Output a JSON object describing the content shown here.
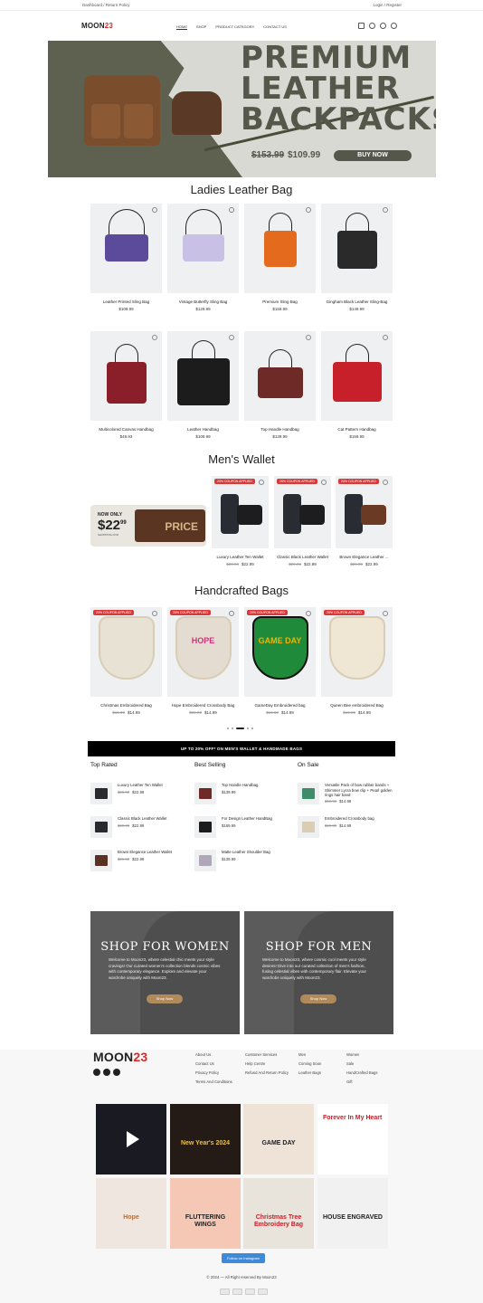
{
  "topbar": {
    "left": "Dashboard / Return Policy",
    "right": "Login / Register"
  },
  "header": {
    "logo": {
      "main": "MOON",
      "accent": "23"
    },
    "nav": [
      "HOME",
      "SHOP",
      "PRODUCT CATEGORY",
      "CONTACT US"
    ]
  },
  "hero": {
    "line1": "PREMIUM",
    "line2": "LEATHER",
    "line3": "BACKPACKS",
    "old_price": "$153.99",
    "new_price": "$109.99",
    "button": "BUY NOW"
  },
  "ladies": {
    "title": "Ladies Leather Bag",
    "items": [
      {
        "name": "Leather Printed Sling Bag",
        "price": "$109.99"
      },
      {
        "name": "Vintage Butterfly Sling Bag",
        "price": "$129.99"
      },
      {
        "name": "Premium Sling Bag",
        "price": "$159.99"
      },
      {
        "name": "Gingham Black Leather Sling-Bag",
        "price": "$149.99"
      },
      {
        "name": "Multicolored Canvas Handbag",
        "price": "$49.93"
      },
      {
        "name": "Leather Handbag",
        "price": "$109.99"
      },
      {
        "name": "Top Handle Handbag",
        "price": "$139.99"
      },
      {
        "name": "Cat Pattern Handbag",
        "price": "$159.99"
      }
    ]
  },
  "mens": {
    "title": "Men's Wallet",
    "promo": {
      "top": "NOW ONLY",
      "price": "$22",
      "cents": "99",
      "small": "SHOPPING FOR",
      "word": "PRICE"
    },
    "badge": "20% COUPON APPLIED",
    "items": [
      {
        "name": "Luxury Leather Ten Wallet",
        "old": "$29.99",
        "price": "$22.99"
      },
      {
        "name": "Classic Black Leather Wallet",
        "old": "$29.99",
        "price": "$22.99"
      },
      {
        "name": "Brown Elegance Leather ...",
        "old": "$29.99",
        "price": "$22.99"
      }
    ]
  },
  "handcrafted": {
    "title": "Handcrafted Bags",
    "badge": "20% COUPON APPLIED",
    "items": [
      {
        "name": "Christmas Embroidered Bag",
        "old": "$19.99",
        "price": "$14.99",
        "label": ""
      },
      {
        "name": "Hope Embroidered Crossbody Bag",
        "old": "$19.99",
        "price": "$14.99",
        "label": "HOPE"
      },
      {
        "name": "GameDay Embroidered bag",
        "old": "$19.99",
        "price": "$14.99",
        "label": "GAME DAY"
      },
      {
        "name": "Queen Bee embroidered Bag",
        "old": "$19.99",
        "price": "$14.99",
        "label": ""
      }
    ]
  },
  "banner": "UP TO 20% OFF* ON MEN'S WALLET & HANDMADE BAGS",
  "lists": {
    "top_rated": {
      "title": "Top Rated",
      "items": [
        {
          "name": "Luxury Leather Ten Wallet",
          "old": "$29.99",
          "price": "$22.99"
        },
        {
          "name": "Classic Black Leather Wallet",
          "old": "$29.99",
          "price": "$22.99"
        },
        {
          "name": "Brown Elegance Leather Wallet",
          "old": "$29.99",
          "price": "$22.99"
        }
      ]
    },
    "best_selling": {
      "title": "Best Selling",
      "items": [
        {
          "name": "Top Handle Handbag",
          "old": "",
          "price": "$139.99"
        },
        {
          "name": "For Design Leather HandBag",
          "old": "",
          "price": "$169.99"
        },
        {
          "name": "Matte Leather Shoulder Bag",
          "old": "",
          "price": "$139.99"
        }
      ]
    },
    "on_sale": {
      "title": "On Sale",
      "items": [
        {
          "name": "Versatile Pack of bow rubber bands + Shimmer Lycra bow clip + Pearl golden rings hair band",
          "old": "$19.99",
          "price": "$14.99"
        },
        {
          "name": "Embroidered Crossbody bag",
          "old": "$19.99",
          "price": "$14.99"
        }
      ]
    }
  },
  "shop_women": {
    "title": "SHOP FOR WOMEN",
    "text": "Welcome to Moon23, where celestial chic meets your style cravings! Our curated women's collection blends cosmic vibes with contemporary elegance. Explore and elevate your wardrobe uniquely with Moon23.",
    "button": "Shop Now"
  },
  "shop_men": {
    "title": "SHOP FOR MEN",
    "text": "Welcome to Moon23, where cosmic cool meets your style desires! Dive into our curated collection of men's fashion, fusing celestial vibes with contemporary flair. Elevate your wardrobe uniquely with Moon23.",
    "button": "Shop Now"
  },
  "footer": {
    "logo": {
      "main": "MOON",
      "accent": "23"
    },
    "col1": [
      "About Us",
      "Contact Us",
      "Privacy Policy",
      "Terms And Conditions"
    ],
    "col2": [
      "Customer Services",
      "Help Centre",
      "Refund And Return Policy"
    ],
    "col3": [
      "Men",
      "Coming Soon",
      "Leather Bags"
    ],
    "col4": [
      "Women",
      "Sale",
      "HandCrafted Bags",
      "Gift"
    ],
    "insta": [
      {
        "text": ""
      },
      {
        "text": "New Year's 2024"
      },
      {
        "text": "GAME DAY"
      },
      {
        "text": "Forever In My Heart"
      },
      {
        "text": "Hope"
      },
      {
        "text": "FLUTTERING WINGS"
      },
      {
        "text": "Christmas Tree Embroidery Bag"
      },
      {
        "text": "HOUSE ENGRAVED"
      }
    ],
    "insta_button": "Follow on Instagram",
    "copyright": "© 2024 — All Right reserved By Moon23"
  },
  "colors": {
    "accent": "#d62b2b",
    "hero_text": "#55574a",
    "badge": "#d83a3a",
    "banner": "#000000",
    "insta": "#3f8ad8"
  }
}
